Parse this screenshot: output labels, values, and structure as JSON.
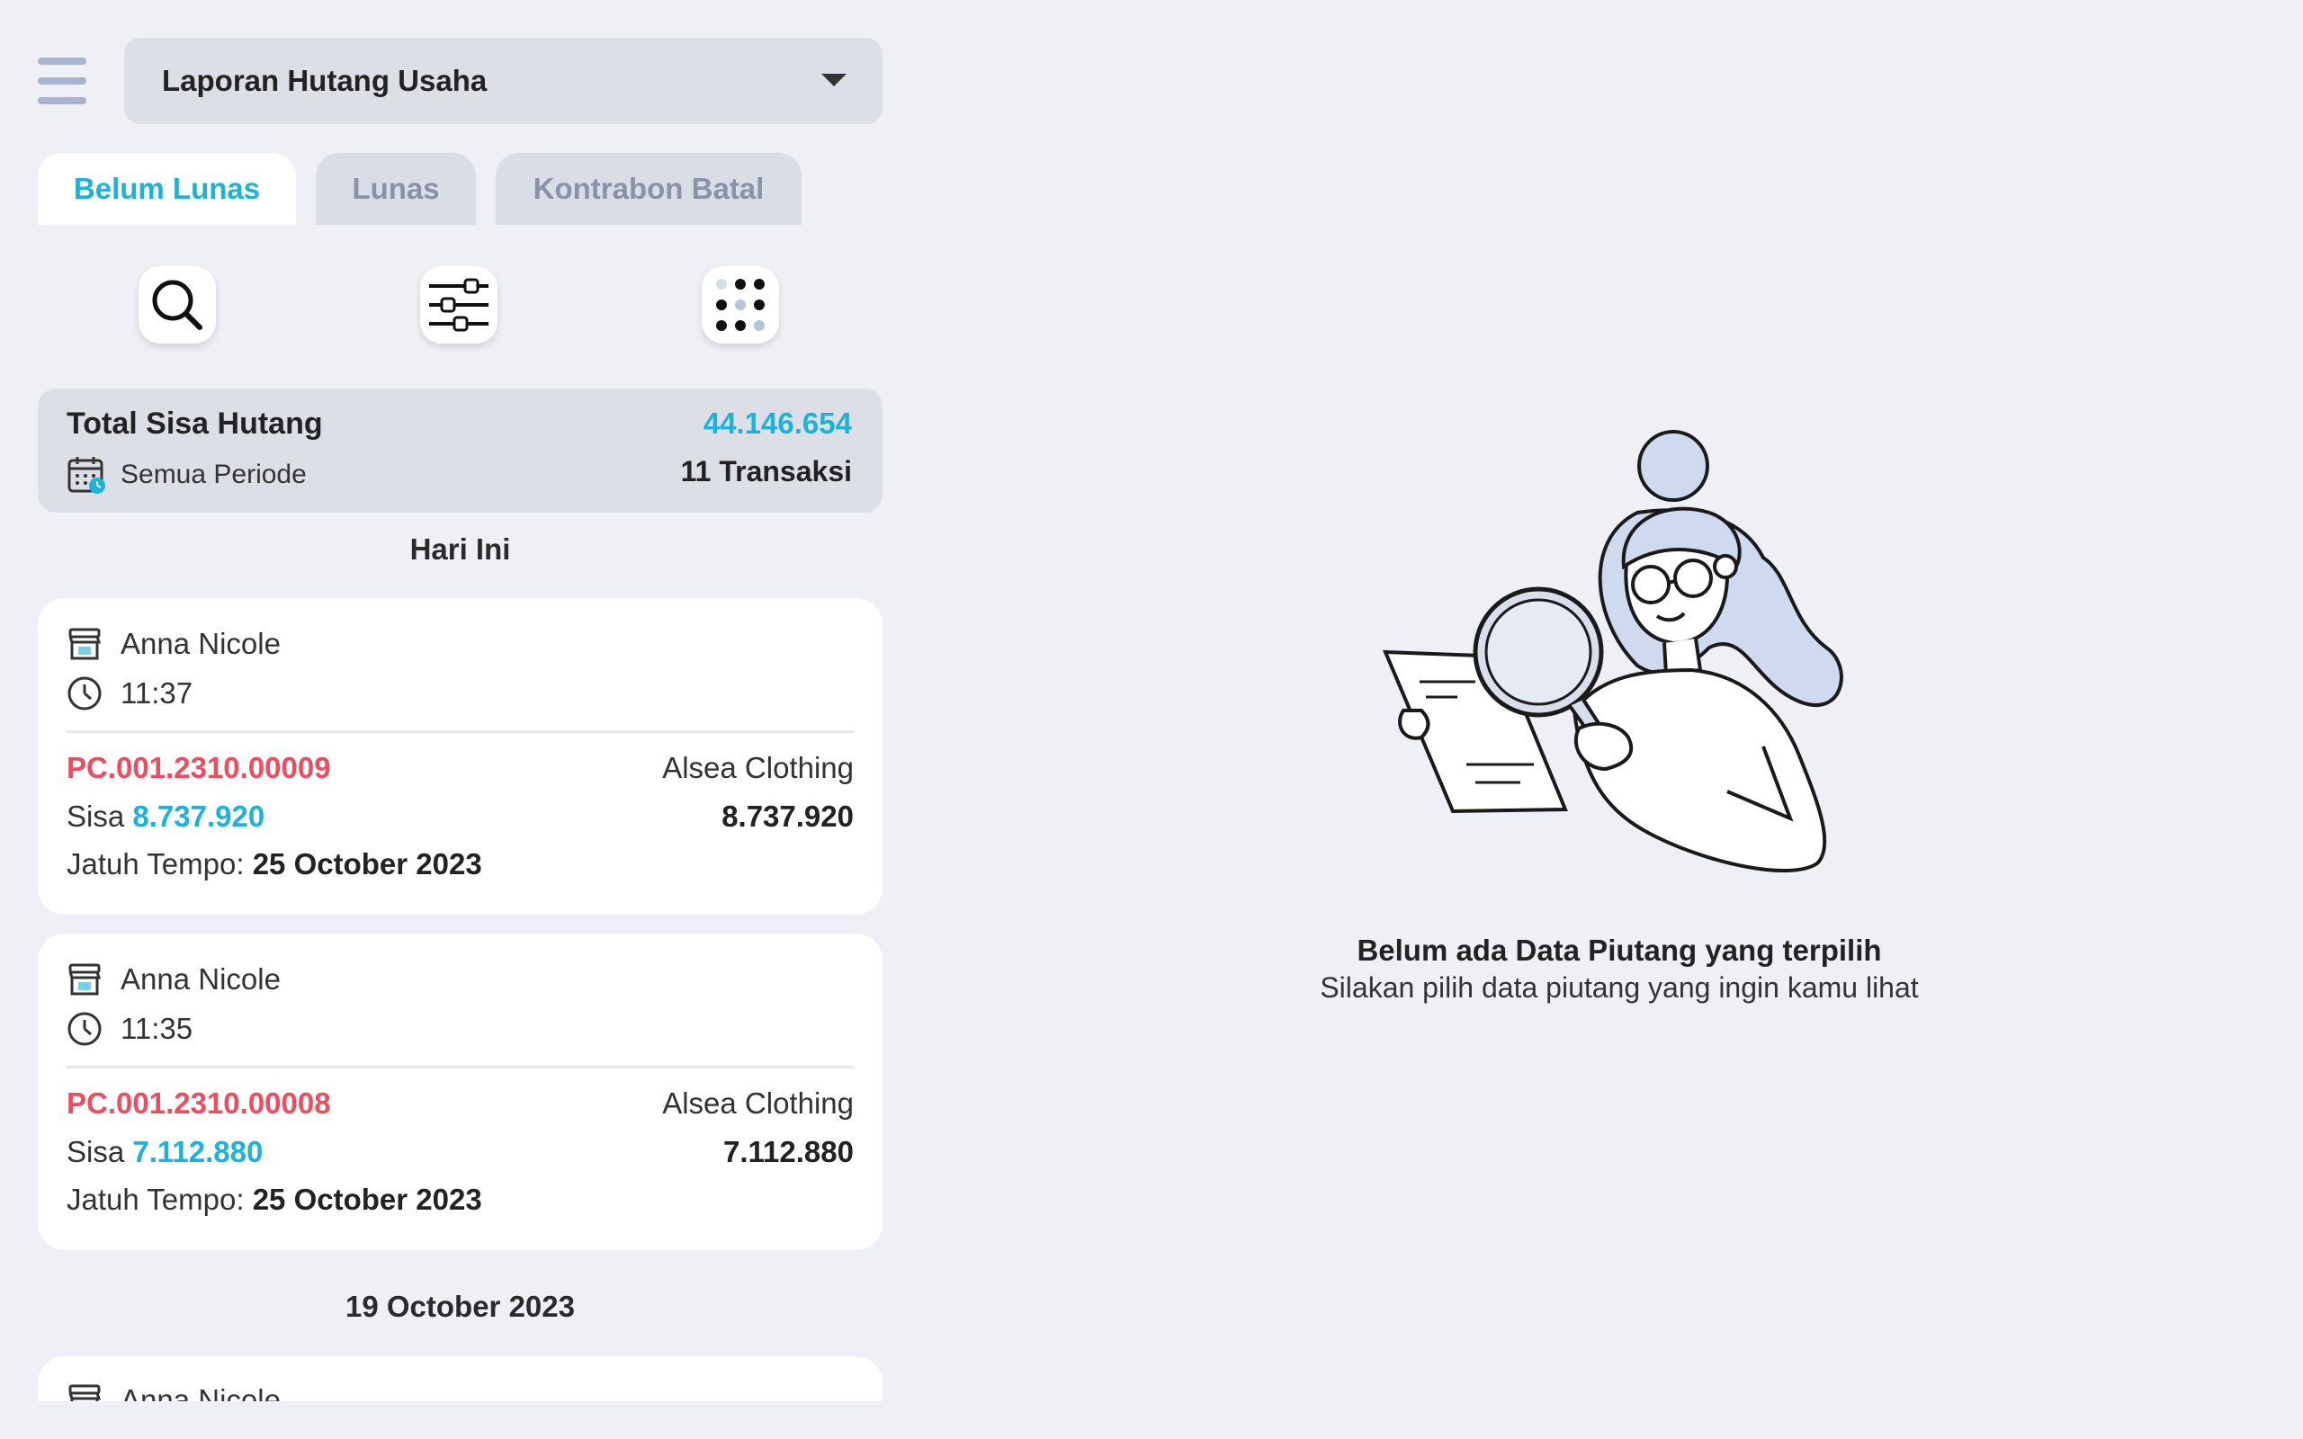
{
  "header": {
    "report_title": "Laporan Hutang Usaha"
  },
  "tabs": [
    {
      "label": "Belum Lunas",
      "active": true
    },
    {
      "label": "Lunas",
      "active": false
    },
    {
      "label": "Kontrabon Batal",
      "active": false
    }
  ],
  "toolbar": {
    "icons": [
      "search-icon",
      "filter-sliders-icon",
      "grid-dots-icon"
    ]
  },
  "summary": {
    "label": "Total Sisa Hutang",
    "amount": "44.146.654",
    "period": "Semua Periode",
    "count": "11 Transaksi"
  },
  "groups": [
    {
      "date": "Hari Ini",
      "items": [
        {
          "name": "Anna Nicole",
          "time": "11:37",
          "invoice": "PC.001.2310.00009",
          "supplier": "Alsea Clothing",
          "sisa_label": "Sisa",
          "sisa": "8.737.920",
          "total": "8.737.920",
          "due_label": "Jatuh Tempo:",
          "due_date": "25 October 2023"
        },
        {
          "name": "Anna Nicole",
          "time": "11:35",
          "invoice": "PC.001.2310.00008",
          "supplier": "Alsea Clothing",
          "sisa_label": "Sisa",
          "sisa": "7.112.880",
          "total": "7.112.880",
          "due_label": "Jatuh Tempo:",
          "due_date": "25 October 2023"
        }
      ]
    },
    {
      "date": "19 October 2023",
      "items": [
        {
          "name": "Anna Nicole"
        }
      ]
    }
  ],
  "empty_state": {
    "title": "Belum ada Data Piutang yang terpilih",
    "subtitle": "Silakan pilih data piutang yang ingin kamu lihat"
  },
  "colors": {
    "accent": "#1db2d8",
    "invoice": "#ee4d5f",
    "background": "#eef0f5"
  }
}
